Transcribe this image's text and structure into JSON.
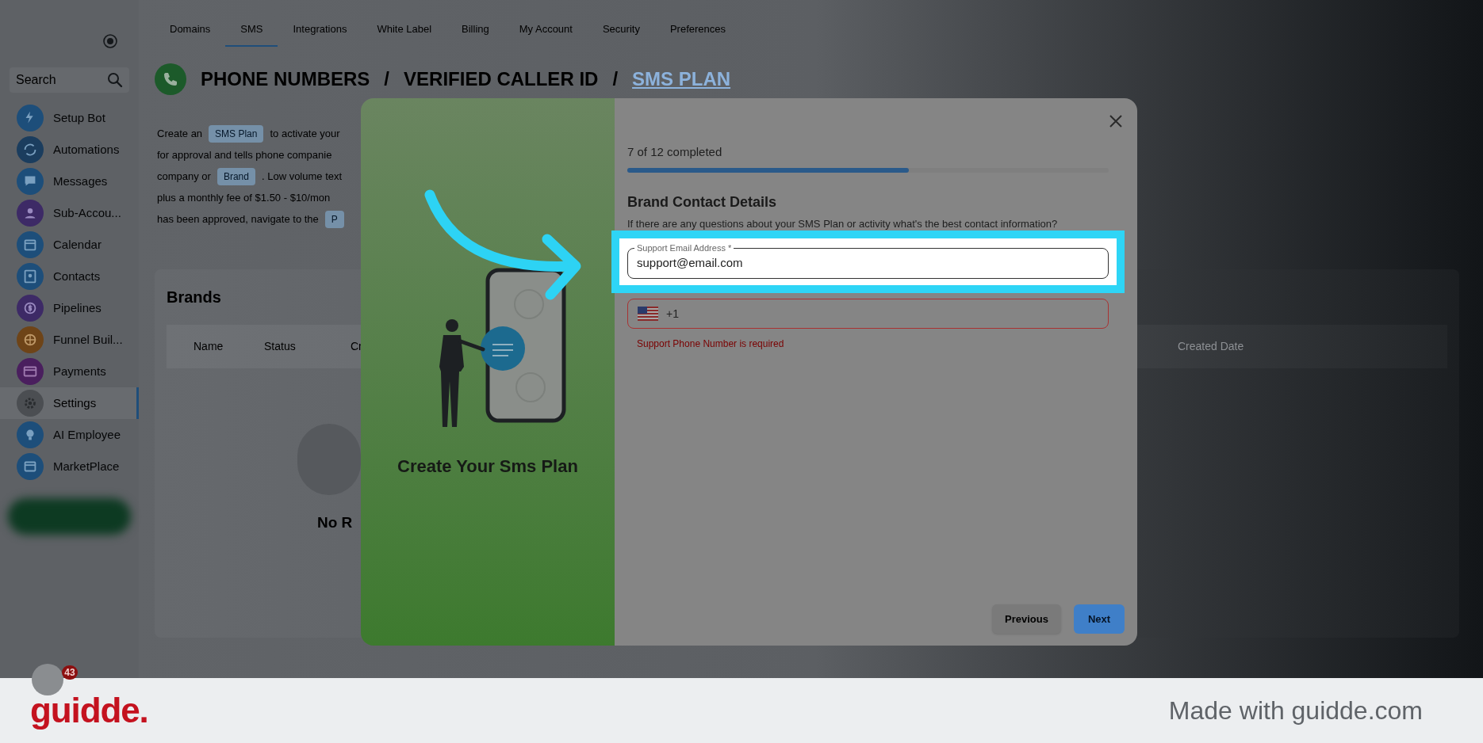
{
  "sidebar": {
    "search": {
      "placeholder": "Search"
    },
    "items": [
      {
        "label": "Setup Bot",
        "selected": false,
        "color": "#1d4e7a"
      },
      {
        "label": "Automations",
        "selected": false,
        "color": "#1b3d5e"
      },
      {
        "label": "Messages",
        "selected": false,
        "color": "#1d4e7a"
      },
      {
        "label": "Sub-Accou...",
        "selected": false,
        "color": "#3d2a66"
      },
      {
        "label": "Calendar",
        "selected": false,
        "color": "#1d4e7a"
      },
      {
        "label": "Contacts",
        "selected": false,
        "color": "#1d4e7a"
      },
      {
        "label": "Pipelines",
        "selected": false,
        "color": "#3d2a66"
      },
      {
        "label": "Funnel Buil...",
        "selected": false,
        "color": "#6e4418"
      },
      {
        "label": "Payments",
        "selected": false,
        "color": "#4a1f5e"
      },
      {
        "label": "Settings",
        "selected": true,
        "color": "#4b4e52"
      },
      {
        "label": "AI Employee",
        "selected": false,
        "color": "#1d4e7a"
      },
      {
        "label": "MarketPlace",
        "selected": false,
        "color": "#1d4e7a"
      }
    ],
    "notification_count": "43"
  },
  "tabs": [
    {
      "label": "Domains",
      "selected": false
    },
    {
      "label": "SMS",
      "selected": true
    },
    {
      "label": "Integrations",
      "selected": false
    },
    {
      "label": "White Label",
      "selected": false
    },
    {
      "label": "Billing",
      "selected": false
    },
    {
      "label": "My Account",
      "selected": false
    },
    {
      "label": "Security",
      "selected": false
    },
    {
      "label": "Preferences",
      "selected": false
    }
  ],
  "breadcrumb": {
    "separator": "/",
    "items": [
      {
        "label": "PHONE NUMBERS",
        "current": false
      },
      {
        "label": "VERIFIED CALLER ID",
        "current": false
      },
      {
        "label": "SMS PLAN",
        "current": true
      }
    ]
  },
  "description": [
    [
      {
        "kind": "text",
        "text": "Create an"
      },
      {
        "kind": "chip",
        "text": "SMS Plan"
      },
      {
        "kind": "text",
        "text": "to activate your"
      }
    ],
    [
      {
        "kind": "text",
        "text": "for approval and tells phone companie"
      }
    ],
    [
      {
        "kind": "text",
        "text": "company or"
      },
      {
        "kind": "chip",
        "text": "Brand"
      },
      {
        "kind": "text",
        "text": ". Low volume text"
      }
    ],
    [
      {
        "kind": "text",
        "text": "plus a monthly fee of $1.50 - $10/mon"
      }
    ],
    [
      {
        "kind": "text",
        "text": "has been approved, navigate to the"
      },
      {
        "kind": "chip",
        "text": "P"
      }
    ]
  ],
  "brands": {
    "title": "Brands",
    "columns": [
      "Name",
      "Status",
      "Cr"
    ],
    "right_column": "Created Date",
    "empty_text": "No R"
  },
  "modal": {
    "side_title": "Create Your Sms Plan",
    "progress_text": "7 of 12 completed",
    "progress": {
      "level": 0.585
    },
    "section_title": "Brand Contact Details",
    "question": "If there are any questions about your SMS Plan or activity what's the best contact information?",
    "email": {
      "label": "Support Email Address *",
      "value": "support@email.com"
    },
    "phone": {
      "value": "+1",
      "error": "Support Phone Number is required"
    },
    "buttons": [
      {
        "label": "Previous",
        "kind": "secondary"
      },
      {
        "label": "Next",
        "kind": "primary"
      }
    ]
  },
  "footer": {
    "logo": "guidde.",
    "text": "Made with guidde.com"
  }
}
